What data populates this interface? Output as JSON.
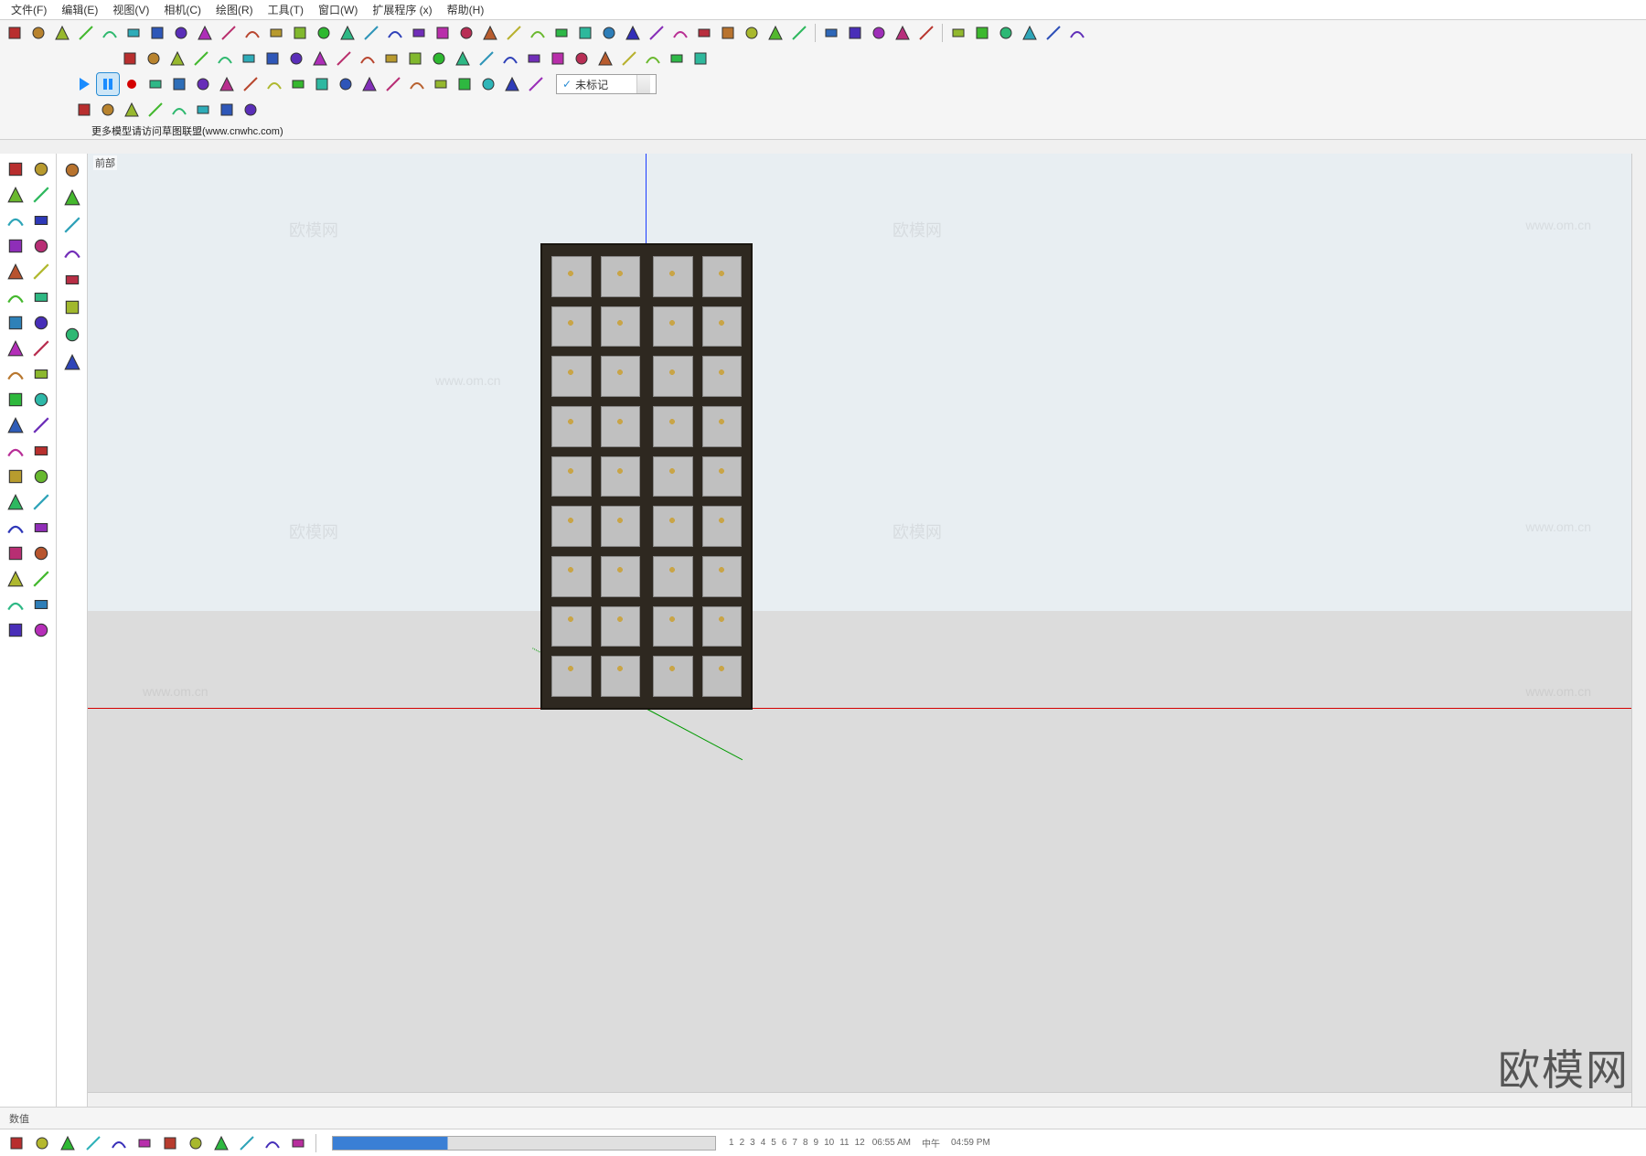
{
  "menu": [
    "文件(F)",
    "编辑(E)",
    "视图(V)",
    "相机(C)",
    "绘图(R)",
    "工具(T)",
    "窗口(W)",
    "扩展程序 (x)",
    "帮助(H)"
  ],
  "info_strip": "更多模型请访问草图联盟(www.cnwhc.com)",
  "view_label": "前部",
  "tag_dropdown": "未标记",
  "status_label": "数值",
  "time": {
    "start": "06:55 AM",
    "mid": "中午",
    "end": "04:59 PM"
  },
  "scale_numbers": [
    "1",
    "2",
    "3",
    "4",
    "5",
    "6",
    "7",
    "8",
    "9",
    "10",
    "11",
    "12"
  ],
  "brand": "欧模网",
  "watermarks": [
    "欧模网",
    "www.om.cn"
  ],
  "toolbar_titles": {
    "row1": [
      "make-component",
      "section",
      "dimensions",
      "stairs",
      "sandbox-1",
      "sandbox-2",
      "sandbox-3",
      "sandbox-4",
      "offset",
      "arc",
      "followme",
      "scale",
      "pushpull",
      "rectangle",
      "paint",
      "rotate",
      "move",
      "tape",
      "circle",
      "line",
      "freehand",
      "text",
      "explode",
      "orbit",
      "pan",
      "zoom",
      "zoom-extents",
      "flip",
      "mirror",
      "styles",
      "layers",
      "outliner",
      "x-ray",
      "shadows",
      "separator",
      "folder",
      "check",
      "cloud",
      "box3d",
      "refresh",
      "separator",
      "3dwarehouse",
      "extension",
      "home",
      "folder2",
      "folder3",
      "folder4"
    ],
    "row2": [
      "pencil",
      "ruler",
      "arrow",
      "box",
      "sphere",
      "cyl",
      "cone",
      "torus",
      "text3d",
      "angle",
      "profile",
      "extrude",
      "section2",
      "layers2",
      "copy",
      "paste",
      "cut",
      "group",
      "ungroup",
      "component",
      "instance",
      "soften",
      "smooth",
      "materials",
      "brush"
    ],
    "row3": [
      "play",
      "pause",
      "record",
      "stop",
      "gear",
      "screen",
      "monitor",
      "help",
      "lightbulb",
      "sun",
      "line2",
      "rect2",
      "hidden",
      "plugin",
      "circle2",
      "camera",
      "photo",
      "refresh2",
      "settings",
      "cube"
    ],
    "row4": [
      "cloud1",
      "cloud2",
      "cloud3",
      "cloud4",
      "select-rect",
      "move2",
      "rotate2",
      "target"
    ]
  }
}
